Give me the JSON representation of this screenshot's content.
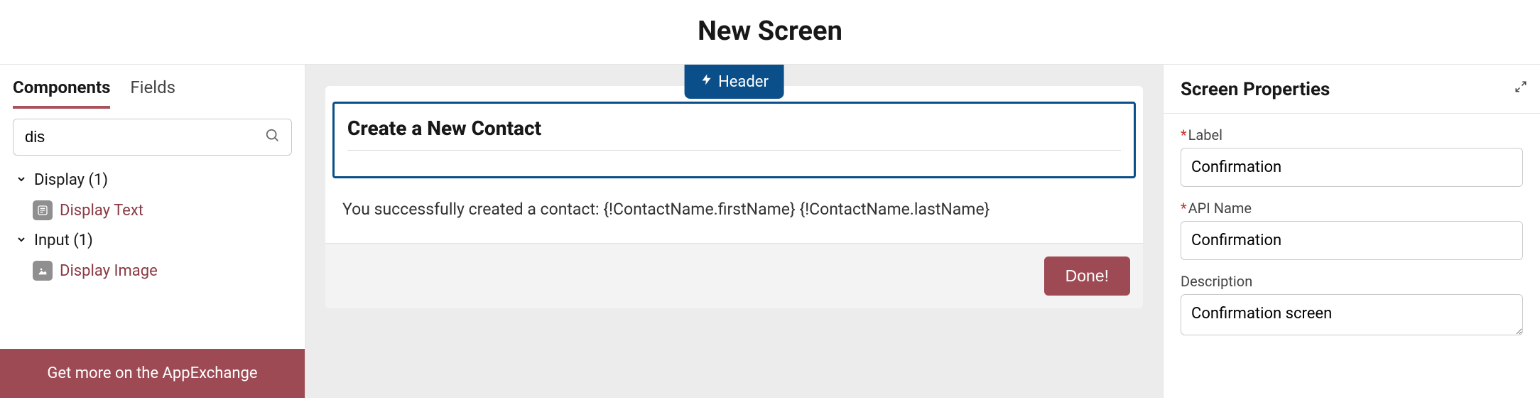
{
  "page_title": "New Screen",
  "left": {
    "tabs": {
      "components": "Components",
      "fields": "Fields"
    },
    "search_value": "dis",
    "groups": [
      {
        "label": "Display  (1)",
        "items": [
          {
            "label": "Display Text",
            "icon": "display-text-icon"
          }
        ]
      },
      {
        "label": "Input  (1)",
        "items": [
          {
            "label": "Display Image",
            "icon": "display-image-icon"
          }
        ]
      }
    ],
    "appexchange": "Get more on the AppExchange"
  },
  "canvas": {
    "header_pill": "Header",
    "screen_title": "Create a New Contact",
    "body_text": "You successfully created a contact: {!ContactName.firstName} {!ContactName.lastName}",
    "done_label": "Done!"
  },
  "props": {
    "title": "Screen Properties",
    "label_field": {
      "label": "Label",
      "value": "Confirmation",
      "required": true
    },
    "api_name_field": {
      "label": "API Name",
      "value": "Confirmation",
      "required": true
    },
    "description_field": {
      "label": "Description",
      "value": "Confirmation screen",
      "required": false
    }
  }
}
